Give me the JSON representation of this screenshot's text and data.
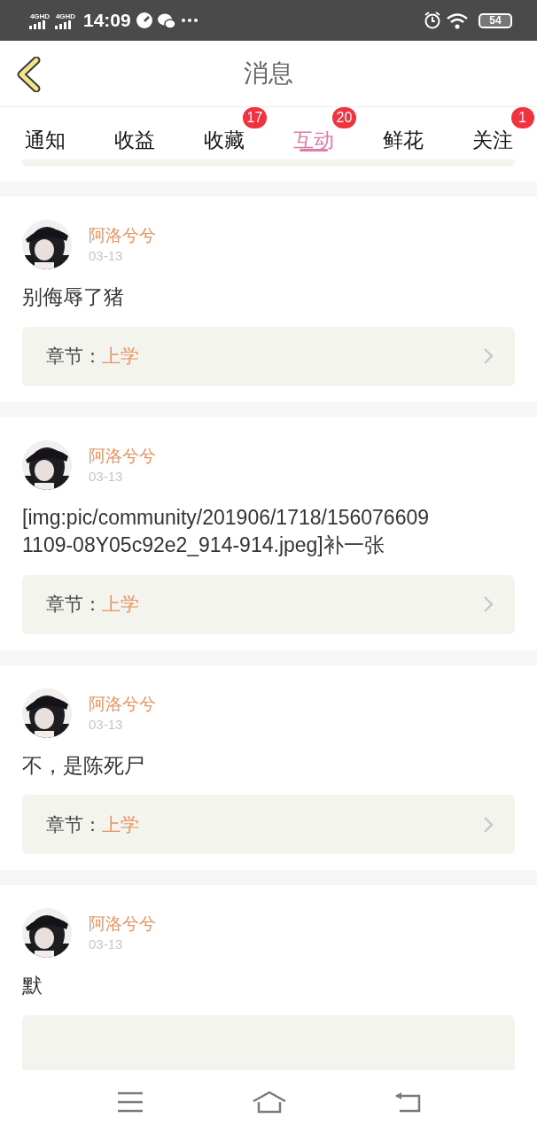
{
  "status_bar": {
    "networks": [
      "4GHD",
      "4GHD"
    ],
    "time": "14:09",
    "battery": "54"
  },
  "header": {
    "title": "消息"
  },
  "tabs": [
    {
      "label": "通知",
      "selected": false
    },
    {
      "label": "收益",
      "selected": false
    },
    {
      "label": "收藏",
      "selected": false,
      "badge": "17"
    },
    {
      "label": "互动",
      "selected": true,
      "badge": "20"
    },
    {
      "label": "鲜花",
      "selected": false
    },
    {
      "label": "关注",
      "selected": false,
      "badge": "1"
    }
  ],
  "messages": [
    {
      "author": "阿洛兮兮",
      "date": "03-13",
      "text": "别侮辱了猪",
      "chapter_label": "章节：",
      "chapter": "上学"
    },
    {
      "author": "阿洛兮兮",
      "date": "03-13",
      "text": "[img:pic/community/201906/1718/1560766091109-08Y05c92e2_914-914.jpeg]补一张",
      "chapter_label": "章节：",
      "chapter": "上学"
    },
    {
      "author": "阿洛兮兮",
      "date": "03-13",
      "text": "不，是陈死尸",
      "chapter_label": "章节：",
      "chapter": "上学"
    },
    {
      "author": "阿洛兮兮",
      "date": "03-13",
      "text": "默"
    }
  ]
}
